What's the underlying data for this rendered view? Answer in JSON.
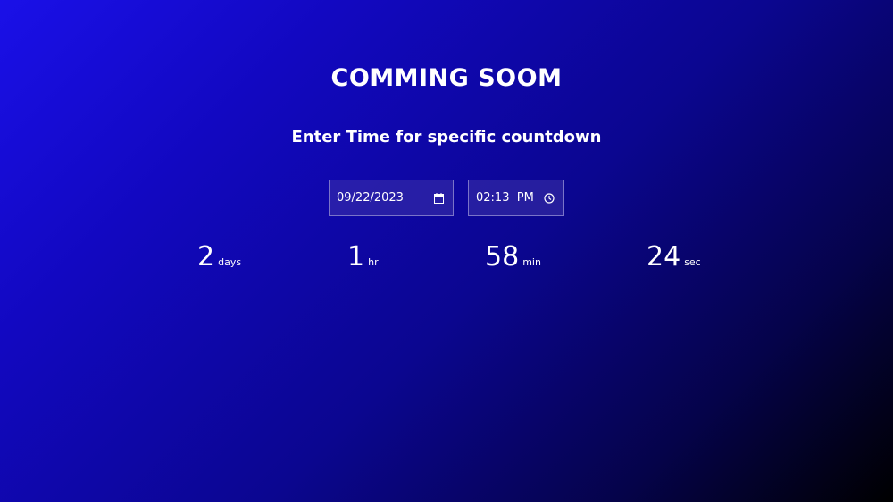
{
  "header": {
    "title": "COMMING SOOM",
    "subtitle": "Enter Time for specific countdown"
  },
  "inputs": {
    "date": {
      "value": "09/22/2023",
      "icon": "calendar-icon"
    },
    "time": {
      "value": "02:13  PM",
      "icon": "clock-icon"
    }
  },
  "countdown": {
    "days": {
      "value": "2",
      "label": "days"
    },
    "hours": {
      "value": "1",
      "label": "hr"
    },
    "minutes": {
      "value": "58",
      "label": "min"
    },
    "seconds": {
      "value": "24",
      "label": "sec"
    }
  },
  "colors": {
    "background_start": "#1a10e8",
    "background_end": "#000000",
    "text": "#ffffff",
    "input_border": "#7a74c8"
  }
}
